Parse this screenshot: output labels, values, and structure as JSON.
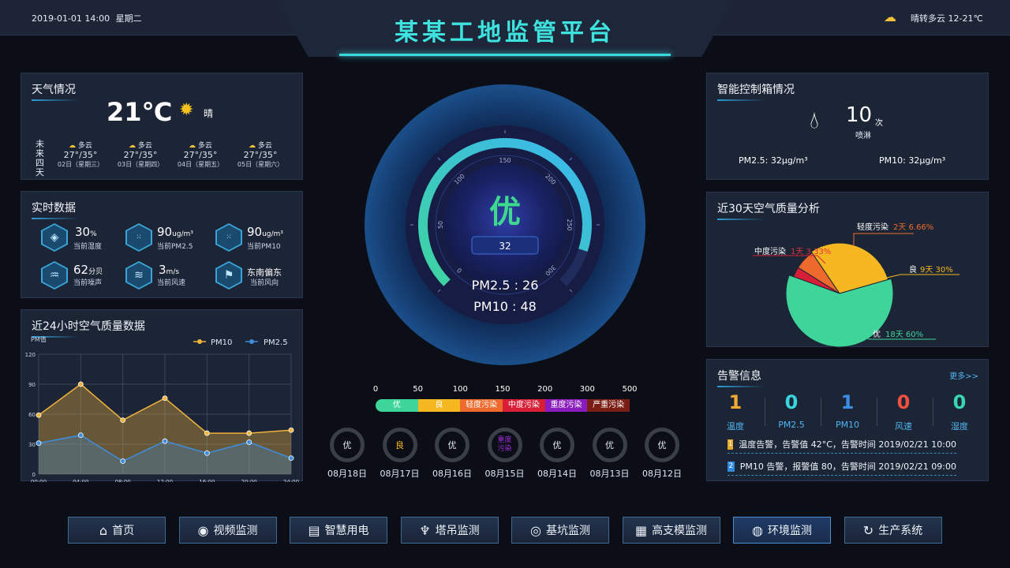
{
  "header": {
    "datetime": "2019-01-01 14:00",
    "weekday": "星期二",
    "title": "某某工地监管平台",
    "weather": "晴转多云 12-21℃"
  },
  "weather_panel": {
    "title": "天气情况",
    "temperature": "21℃",
    "condition": "晴",
    "forecast_label": [
      "未",
      "来",
      "四",
      "天"
    ],
    "forecast": [
      {
        "cond": "多云",
        "temp": "27°/35°",
        "date": "02日（星期三）"
      },
      {
        "cond": "多云",
        "temp": "27°/35°",
        "date": "03日（星期四）"
      },
      {
        "cond": "多云",
        "temp": "27°/35°",
        "date": "04日（星期五）"
      },
      {
        "cond": "多云",
        "temp": "27°/35°",
        "date": "05日（星期六）"
      }
    ]
  },
  "realtime": {
    "title": "实时数据",
    "items": [
      {
        "value": "30",
        "unit": "%",
        "label": "当前湿度",
        "icon": "droplet-icon"
      },
      {
        "value": "90",
        "unit": "ug/m³",
        "label": "当前PM2.5",
        "icon": "pm25-icon"
      },
      {
        "value": "90",
        "unit": "ug/m³",
        "label": "当前PM10",
        "icon": "pm10-icon"
      },
      {
        "value": "62",
        "unit": "分贝",
        "label": "当前噪声",
        "icon": "noise-icon"
      },
      {
        "value": "3",
        "unit": "m/s",
        "label": "当前风速",
        "icon": "wind-icon"
      },
      {
        "value": "东南偏东",
        "unit": "",
        "label": "当前风向",
        "icon": "flag-icon"
      }
    ]
  },
  "line_chart": {
    "title": "近24小时空气质量数据"
  },
  "chart_data": {
    "type": "line",
    "ylabel": "PM值",
    "ylim": [
      0,
      120
    ],
    "yticks": [
      "0",
      "30",
      "60",
      "90",
      "120"
    ],
    "categories": [
      "00:00",
      "04:00",
      "08:00",
      "12:00",
      "16:00",
      "20:00",
      "24:00"
    ],
    "series": [
      {
        "name": "PM10",
        "color": "#f0b43c",
        "values": [
          59,
          90,
          54,
          76,
          41,
          41,
          44
        ]
      },
      {
        "name": "PM2.5",
        "color": "#3f8ddb",
        "values": [
          31,
          39,
          13,
          33,
          21,
          32,
          16
        ]
      }
    ],
    "grid": true,
    "legend": "top-right"
  },
  "gauge": {
    "grade": "优",
    "value": "32",
    "value_num": 32,
    "max": 300,
    "ticks": [
      "0",
      "50",
      "100",
      "150",
      "200",
      "250",
      "300"
    ],
    "pm25": "PM2.5 : 26",
    "pm10": "PM10 : 48"
  },
  "aqi_scale": {
    "ticks": [
      "0",
      "50",
      "100",
      "150",
      "200",
      "300",
      "500"
    ],
    "levels": [
      {
        "label": "优",
        "color": "#3ed59a"
      },
      {
        "label": "良",
        "color": "#f5b820"
      },
      {
        "label": "轻度污染",
        "color": "#ee6a2c"
      },
      {
        "label": "中度污染",
        "color": "#d81e36"
      },
      {
        "label": "重度污染",
        "color": "#8a1bbd"
      },
      {
        "label": "严重污染",
        "color": "#7a1d14"
      }
    ]
  },
  "history": [
    {
      "grade": "优",
      "date": "08月18日",
      "color": "#dfe8f5"
    },
    {
      "grade": "良",
      "date": "08月17日",
      "color": "#f5b820"
    },
    {
      "grade": "优",
      "date": "08月16日",
      "color": "#dfe8f5"
    },
    {
      "grade": "重度\n污染",
      "date": "08月15日",
      "color": "#9b2fd0"
    },
    {
      "grade": "优",
      "date": "08月14日",
      "color": "#dfe8f5"
    },
    {
      "grade": "优",
      "date": "08月13日",
      "color": "#dfe8f5"
    },
    {
      "grade": "优",
      "date": "08月12日",
      "color": "#dfe8f5"
    }
  ],
  "control_box": {
    "title": "智能控制箱情况",
    "count": "10",
    "count_unit": "次",
    "count_label": "喷淋",
    "pm25": "PM2.5: 32μg/m³",
    "pm10": "PM10: 32μg/m³"
  },
  "pie": {
    "title": "近30天空气质量分析",
    "slices": [
      {
        "name": "优",
        "text": "18天 60%",
        "value": 60,
        "color": "#3ed49a"
      },
      {
        "name": "良",
        "text": "9天 30%",
        "value": 30,
        "color": "#f5b820"
      },
      {
        "name": "轻度污染",
        "text": "2天 6.66%",
        "value": 6.66,
        "color": "#ee6a2c"
      },
      {
        "name": "中度污染",
        "text": "1天 3.33%",
        "value": 3.33,
        "color": "#d81e36"
      }
    ]
  },
  "alarm": {
    "title": "告警信息",
    "more": "更多>>",
    "stats": [
      {
        "value": "1",
        "label": "温度",
        "color": "#f0a830"
      },
      {
        "value": "0",
        "label": "PM2.5",
        "color": "#3ad6e0"
      },
      {
        "value": "1",
        "label": "PM10",
        "color": "#3b8ee6"
      },
      {
        "value": "0",
        "label": "风速",
        "color": "#f05040"
      },
      {
        "value": "0",
        "label": "湿度",
        "color": "#3ad6b0"
      }
    ],
    "items": [
      {
        "index": "1",
        "text": "温度告警，告警值 42°C，告警时间 2019/02/21 10:00",
        "color": "#e8a82a"
      },
      {
        "index": "2",
        "text": "PM10 告警，报警值 80，告警时间 2019/02/21 09:00",
        "color": "#2f8be0"
      }
    ]
  },
  "nav": [
    {
      "label": "首页",
      "icon": "home-icon",
      "glyph": "⌂"
    },
    {
      "label": "视频监测",
      "icon": "camera-icon",
      "glyph": "◉"
    },
    {
      "label": "智慧用电",
      "icon": "electric-icon",
      "glyph": "▤"
    },
    {
      "label": "塔吊监测",
      "icon": "crane-icon",
      "glyph": "♆"
    },
    {
      "label": "基坑监测",
      "icon": "pit-icon",
      "glyph": "◎"
    },
    {
      "label": "高支模监测",
      "icon": "grid-icon",
      "glyph": "▦"
    },
    {
      "label": "环境监测",
      "icon": "environment-icon",
      "glyph": "◍"
    },
    {
      "label": "生产系统",
      "icon": "cycle-icon",
      "glyph": "↻"
    }
  ]
}
